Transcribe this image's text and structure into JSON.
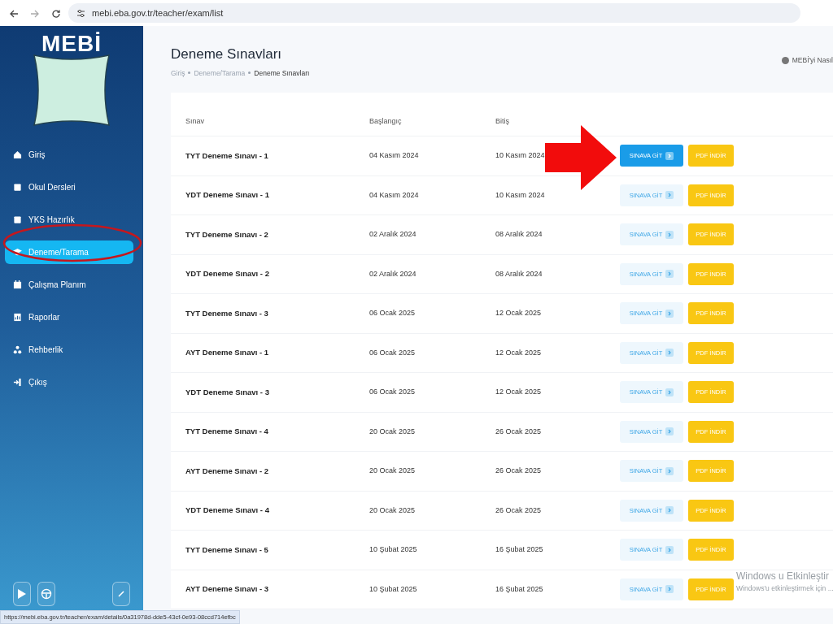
{
  "browser": {
    "url": "mebi.eba.gov.tr/teacher/exam/list"
  },
  "sidebar": {
    "logo": "MEBİ",
    "items": [
      {
        "label": "Giriş",
        "selected": false
      },
      {
        "label": "Okul Dersleri",
        "selected": false
      },
      {
        "label": "YKS Hazırlık",
        "selected": false
      },
      {
        "label": "Deneme/Tarama",
        "selected": true
      },
      {
        "label": "Çalışma Planım",
        "selected": false
      },
      {
        "label": "Raporlar",
        "selected": false
      },
      {
        "label": "Rehberlik",
        "selected": false
      },
      {
        "label": "Çıkış",
        "selected": false
      }
    ]
  },
  "page": {
    "title": "Deneme Sınavları",
    "breadcrumb": [
      "Giriş",
      "Deneme/Tarama",
      "Deneme Sınavları"
    ],
    "help_link": "MEBİ'yi Nasıl"
  },
  "table": {
    "columns": [
      "Sınav",
      "Başlangıç",
      "Bitiş"
    ],
    "rows": [
      {
        "name": "TYT Deneme Sınavı - 1",
        "start": "04 Kasım 2024",
        "end": "10 Kasım 2024",
        "go": "SINAVA GİT",
        "pdf": "PDF İNDİR",
        "highlighted": true
      },
      {
        "name": "YDT Deneme Sınavı - 1",
        "start": "04 Kasım 2024",
        "end": "10 Kasım 2024",
        "go": "SINAVA GİT",
        "pdf": "PDF İNDİR",
        "highlighted": false
      },
      {
        "name": "TYT Deneme Sınavı - 2",
        "start": "02 Aralık 2024",
        "end": "08 Aralık 2024",
        "go": "SINAVA GİT",
        "pdf": "PDF İNDİR",
        "highlighted": false
      },
      {
        "name": "YDT Deneme Sınavı - 2",
        "start": "02 Aralık 2024",
        "end": "08 Aralık 2024",
        "go": "SINAVA GİT",
        "pdf": "PDF İNDİR",
        "highlighted": false
      },
      {
        "name": "TYT Deneme Sınavı - 3",
        "start": "06 Ocak 2025",
        "end": "12 Ocak 2025",
        "go": "SINAVA GİT",
        "pdf": "PDF İNDİR",
        "highlighted": false
      },
      {
        "name": "AYT Deneme Sınavı - 1",
        "start": "06 Ocak 2025",
        "end": "12 Ocak 2025",
        "go": "SINAVA GİT",
        "pdf": "PDF İNDİR",
        "highlighted": false
      },
      {
        "name": "YDT Deneme Sınavı - 3",
        "start": "06 Ocak 2025",
        "end": "12 Ocak 2025",
        "go": "SINAVA GİT",
        "pdf": "PDF İNDİR",
        "highlighted": false
      },
      {
        "name": "TYT Deneme Sınavı - 4",
        "start": "20 Ocak 2025",
        "end": "26 Ocak 2025",
        "go": "SINAVA GİT",
        "pdf": "PDF İNDİR",
        "highlighted": false
      },
      {
        "name": "AYT Deneme Sınavı - 2",
        "start": "20 Ocak 2025",
        "end": "26 Ocak 2025",
        "go": "SINAVA GİT",
        "pdf": "PDF İNDİR",
        "highlighted": false
      },
      {
        "name": "YDT Deneme Sınavı - 4",
        "start": "20 Ocak 2025",
        "end": "26 Ocak 2025",
        "go": "SINAVA GİT",
        "pdf": "PDF İNDİR",
        "highlighted": false
      },
      {
        "name": "TYT Deneme Sınavı - 5",
        "start": "10 Şubat 2025",
        "end": "16 Şubat 2025",
        "go": "SINAVA GİT",
        "pdf": "PDF İNDİR",
        "highlighted": false
      },
      {
        "name": "AYT Deneme Sınavı - 3",
        "start": "10 Şubat 2025",
        "end": "16 Şubat 2025",
        "go": "SINAVA GİT",
        "pdf": "PDF İNDİR",
        "highlighted": false
      }
    ]
  },
  "status_url": "https://mebi.eba.gov.tr/teacher/exam/details/0a31978d-dde5-43cf-0e93-08ccd714efbc",
  "windows_activation": {
    "title": "Windows u Etkinleştir",
    "text": "Windows'u etkinleştirmek için ..."
  }
}
